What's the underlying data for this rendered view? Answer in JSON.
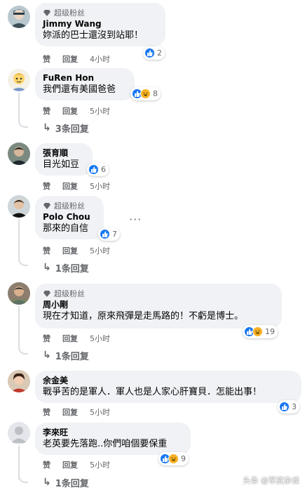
{
  "comments": [
    {
      "badge": "超级粉丝",
      "name": "Jimmy Wang",
      "text": "妳派的巴士還沒到站耶！",
      "reactions": {
        "types": [
          "like"
        ],
        "count": "2"
      },
      "actions": {
        "like": "赞",
        "reply": "回复",
        "time": "4小时"
      },
      "replies": ""
    },
    {
      "badge": "",
      "name": "FuRen Hon",
      "text": "我們還有美國爸爸",
      "reactions": {
        "types": [
          "like",
          "haha"
        ],
        "count": "8"
      },
      "actions": {
        "like": "赞",
        "reply": "回复",
        "time": "5小时"
      },
      "replies": "3条回复"
    },
    {
      "badge": "",
      "name": "張育順",
      "text": "目光如豆",
      "reactions": {
        "types": [
          "like"
        ],
        "count": "6"
      },
      "actions": {
        "like": "赞",
        "reply": "回复",
        "time": "5小时"
      },
      "replies": ""
    },
    {
      "badge": "超级粉丝",
      "name": "Polo Chou",
      "text": "那來的自信",
      "reactions": {
        "types": [
          "like"
        ],
        "count": "7"
      },
      "actions": {
        "like": "赞",
        "reply": "回复",
        "time": "5小时"
      },
      "replies": "1条回复",
      "more": "···"
    },
    {
      "badge": "超级粉丝",
      "name": "周小剛",
      "text": "現在才知道，原來飛彈是走馬路的！不虧是博士。",
      "reactions": {
        "types": [
          "like",
          "haha"
        ],
        "count": "19"
      },
      "actions": {
        "like": "赞",
        "reply": "回复",
        "time": "5小时"
      },
      "replies": "1条回复"
    },
    {
      "badge": "",
      "name": "余金美",
      "text": "戰爭苦的是軍人．軍人也是人家心肝寶貝．怎能出事！",
      "reactions": {
        "types": [
          "like"
        ],
        "count": "3"
      },
      "actions": {
        "like": "赞",
        "reply": "回复",
        "time": "5小时"
      },
      "replies": ""
    },
    {
      "badge": "",
      "name": "李來旺",
      "text": "老英要先落跑..你們咱個要保重",
      "reactions": {
        "types": [
          "like",
          "haha"
        ],
        "count": "9"
      },
      "actions": {
        "like": "赞",
        "reply": "回复",
        "time": "5小时"
      },
      "replies": "1条回复"
    }
  ],
  "watermark": "头条 @军武杂谈",
  "colors": {
    "like": "#1877f2",
    "haha": "#f7b125",
    "bubble": "#f0f2f5",
    "meta": "#65676b"
  }
}
